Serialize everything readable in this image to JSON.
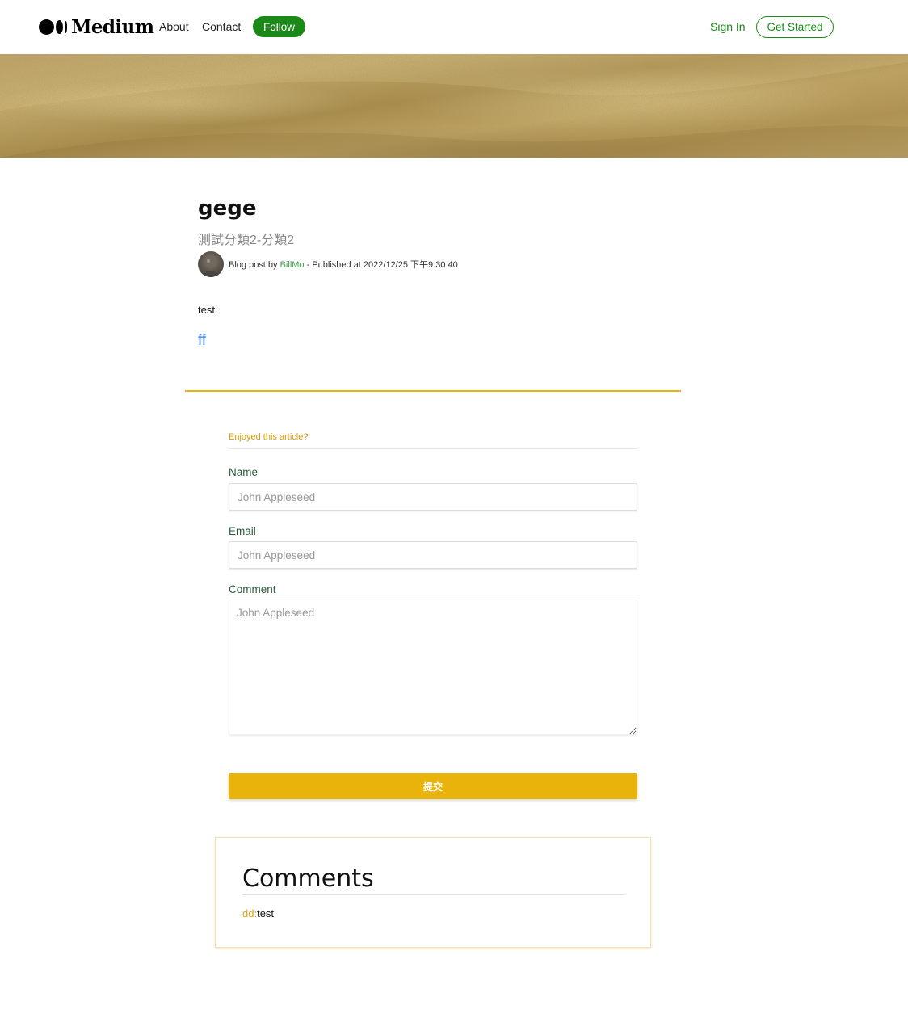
{
  "header": {
    "logo_text": "Medium",
    "nav": {
      "about": "About",
      "contact": "Contact"
    },
    "follow_label": "Follow",
    "signin_label": "Sign In",
    "getstarted_label": "Get Started"
  },
  "hero": {
    "image": "sand-dunes-texture"
  },
  "article": {
    "title": "gege",
    "subtitle": "測試分類2-分類2",
    "meta": {
      "prefix": "Blog post by ",
      "author": "BillMo",
      "published": " - Published at 2022/12/25 下午9:30:40"
    },
    "body": "test",
    "link": "ff"
  },
  "form": {
    "heading": "Enjoyed this article?",
    "name_label": "Name",
    "name_placeholder": "John Appleseed",
    "email_label": "Email",
    "email_placeholder": "John Appleseed",
    "comment_label": "Comment",
    "comment_placeholder": "John Appleseed",
    "submit_label": "提交"
  },
  "comments": {
    "title": "Comments",
    "items": [
      {
        "author": "dd",
        "separator": ":",
        "text": "test"
      }
    ]
  },
  "colors": {
    "brand_green": "#1a8917",
    "accent_gold": "#e8b30a",
    "link_blue": "#3a7bd5",
    "author_green": "#3aa14b"
  }
}
